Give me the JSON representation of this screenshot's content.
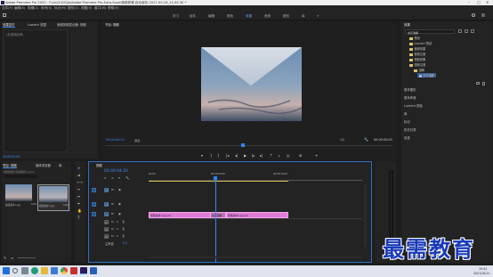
{
  "window": {
    "title": "Adobe Premiere Pro 2020 - F:\\jm\\2020\\jb\\Adobe Premiere Pro Auto-Save\\视频剪辑 自动保存-2021-09-16_14-34-30 *"
  },
  "menu": [
    "文件(F)",
    "编辑(E)",
    "剪辑(C)",
    "序列(S)",
    "标记(M)",
    "图形(G)",
    "视图(V)",
    "窗口(W)",
    "帮助(H)"
  ],
  "workspaces": [
    {
      "label": "学习",
      "active": false
    },
    {
      "label": "组件",
      "active": false
    },
    {
      "label": "编辑",
      "active": false
    },
    {
      "label": "颜色",
      "active": false
    },
    {
      "label": "效果",
      "active": true
    },
    {
      "label": "音频",
      "active": false
    },
    {
      "label": "图形",
      "active": false
    },
    {
      "label": "库",
      "active": false
    }
  ],
  "source_panel": {
    "tabs": [
      "效果控件",
      "Lumetri 范围",
      "音频剪辑混合器: 视频",
      "音频轨道混合器"
    ],
    "empty_text": "(未选择剪辑)",
    "timecode": "00:00:00:00"
  },
  "program": {
    "tab": "节目: 视频",
    "timecode_left": "00:00:04:20",
    "zoom": "适合",
    "quality": "1/2",
    "timecode_right": "00:00:05:00"
  },
  "project": {
    "tabs": [
      "项目: 视频",
      "媒体浏览器",
      "库"
    ],
    "file_name": "视频剪辑 自动保存.prproj",
    "items": [
      {
        "name": "视频素材1.jpg",
        "duration": "5:00"
      },
      {
        "name": "视频素材2.jpg",
        "duration": "5:00"
      }
    ]
  },
  "timeline": {
    "tab": "视频",
    "timecode": "00:00:04:20",
    "ruler": [
      "00:00",
      "00:00:05:00",
      "00:00:10:00"
    ],
    "tracks": [
      {
        "name": "V3",
        "type": "video"
      },
      {
        "name": "V2",
        "type": "video"
      },
      {
        "name": "V1",
        "type": "video"
      },
      {
        "name": "A1",
        "type": "audio"
      },
      {
        "name": "A2",
        "type": "audio"
      },
      {
        "name": "A3",
        "type": "audio"
      }
    ],
    "master": {
      "label": "主声道",
      "value": "0.0"
    },
    "clips": [
      {
        "name": "视频素材1.jpg [V]",
        "track": "V1"
      },
      {
        "name": "交叉溶解",
        "track": "V1"
      },
      {
        "name": "视频素材2.jpg [V]",
        "track": "V1"
      }
    ]
  },
  "effects": {
    "tab": "效果",
    "search": "交叉溶解",
    "tree": [
      {
        "label": "预设",
        "indent": 1
      },
      {
        "label": "Lumetri 预设",
        "indent": 1
      },
      {
        "label": "音频效果",
        "indent": 1
      },
      {
        "label": "音频过渡",
        "indent": 1
      },
      {
        "label": "视频效果",
        "indent": 1
      },
      {
        "label": "视频过渡",
        "indent": 1
      },
      {
        "label": "溶解",
        "indent": 2
      },
      {
        "label": "交叉溶解",
        "indent": 3,
        "selected": true
      }
    ],
    "sections": [
      "基本图形",
      "基本声音",
      "Lumetri 颜色",
      "库",
      "标记",
      "历史记录",
      "信息"
    ]
  },
  "taskbar": {
    "time": "15:41",
    "date": "2021/10/11"
  },
  "watermark": "最需教育",
  "colors": {
    "accent": "#3d8cf0",
    "clip": "#e07bd8",
    "playhead": "#2e86ff"
  }
}
